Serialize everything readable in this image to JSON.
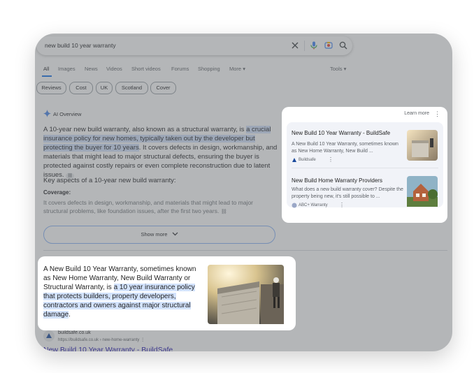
{
  "search": {
    "query": "new build 10 year warranty"
  },
  "tabs": [
    "All",
    "Images",
    "News",
    "Videos",
    "Short videos",
    "Forums",
    "Shopping",
    "More",
    "Tools"
  ],
  "chips": [
    "Reviews",
    "Cost",
    "UK",
    "Scotland",
    "Cover"
  ],
  "ai_overview": {
    "label": "AI Overview",
    "para_pre": "A 10-year new build warranty, also known as a structural warranty, is ",
    "para_hl": "a crucial insurance policy for new homes, typically taken out by the developer but protecting the buyer for 10 years",
    "para_post": ". It covers defects in design, workmanship, and materials that might lead to major structural defects, ensuring the buyer is protected against costly repairs or even complete reconstruction due to latent issues.",
    "subheading": "Key aspects of a 10-year new build warranty:",
    "coverage_label": "Coverage:",
    "coverage_text": "It covers defects in design, workmanship, and materials that might lead to major structural problems, like foundation issues, after the first two years.",
    "show_more": "Show more"
  },
  "sources": {
    "learn_more": "Learn more",
    "items": [
      {
        "title": "New Build 10 Year Warranty - BuildSafe",
        "desc": "A New Build 10 Year Warranty, sometimes known as New Home Warranty, New Build ...",
        "site": "Buildsafe"
      },
      {
        "title": "New Build Home Warranty Providers",
        "desc": "What does a new build warranty cover? Despite the property being new, it's still possible to ...",
        "site": "ABC+ Warranty"
      }
    ]
  },
  "quote": {
    "pre": "A New Build 10 Year Warranty, sometimes known as New Home Warranty, New Build Warranty or Structural Warranty, is ",
    "hl": "a 10 year insurance policy that protects builders, property developers, contractors and owners against major structural damage",
    "post": "."
  },
  "result": {
    "site": "buildsafe.co.uk",
    "url": "https://buildsafe.co.uk › new-home-warranty",
    "title": "New Build 10 Year Warranty - BuildSafe"
  },
  "colors": {
    "accent": "#1a73e8",
    "highlight": "#d3e3fd",
    "link": "#1a0dab"
  }
}
